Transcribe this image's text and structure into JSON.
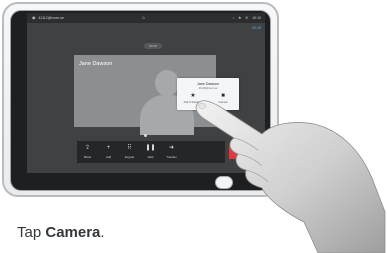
{
  "status_bar": {
    "left_text": "41112@room.se",
    "center_icon": "home-icon",
    "right_icons": [
      "headset-icon",
      "settings-icon",
      "phone-icon"
    ],
    "time": "10:10",
    "sub_right": "00:15"
  },
  "call": {
    "duration": "00:15",
    "participant_name": "Jane Dawson"
  },
  "popup": {
    "name": "Jane Dawson",
    "number": "41116@room.se",
    "actions": [
      {
        "label": "Add To Favorites",
        "icon": "star-icon"
      },
      {
        "label": "Camera",
        "icon": "camera-icon"
      }
    ]
  },
  "toolbar": {
    "buttons": [
      {
        "label": "Share",
        "icon": "share-icon"
      },
      {
        "label": "Add",
        "icon": "add-icon"
      },
      {
        "label": "Keypad",
        "icon": "keypad-icon"
      },
      {
        "label": "Hold",
        "icon": "pause-icon"
      },
      {
        "label": "Transfer",
        "icon": "transfer-icon"
      }
    ],
    "end_label": "End"
  },
  "caption": {
    "prefix": "Tap ",
    "bold": "Camera",
    "suffix": "."
  },
  "colors": {
    "end_button": "#e5383e",
    "screen_bg": "#3f4143",
    "link_blue": "#5fb4e6"
  }
}
